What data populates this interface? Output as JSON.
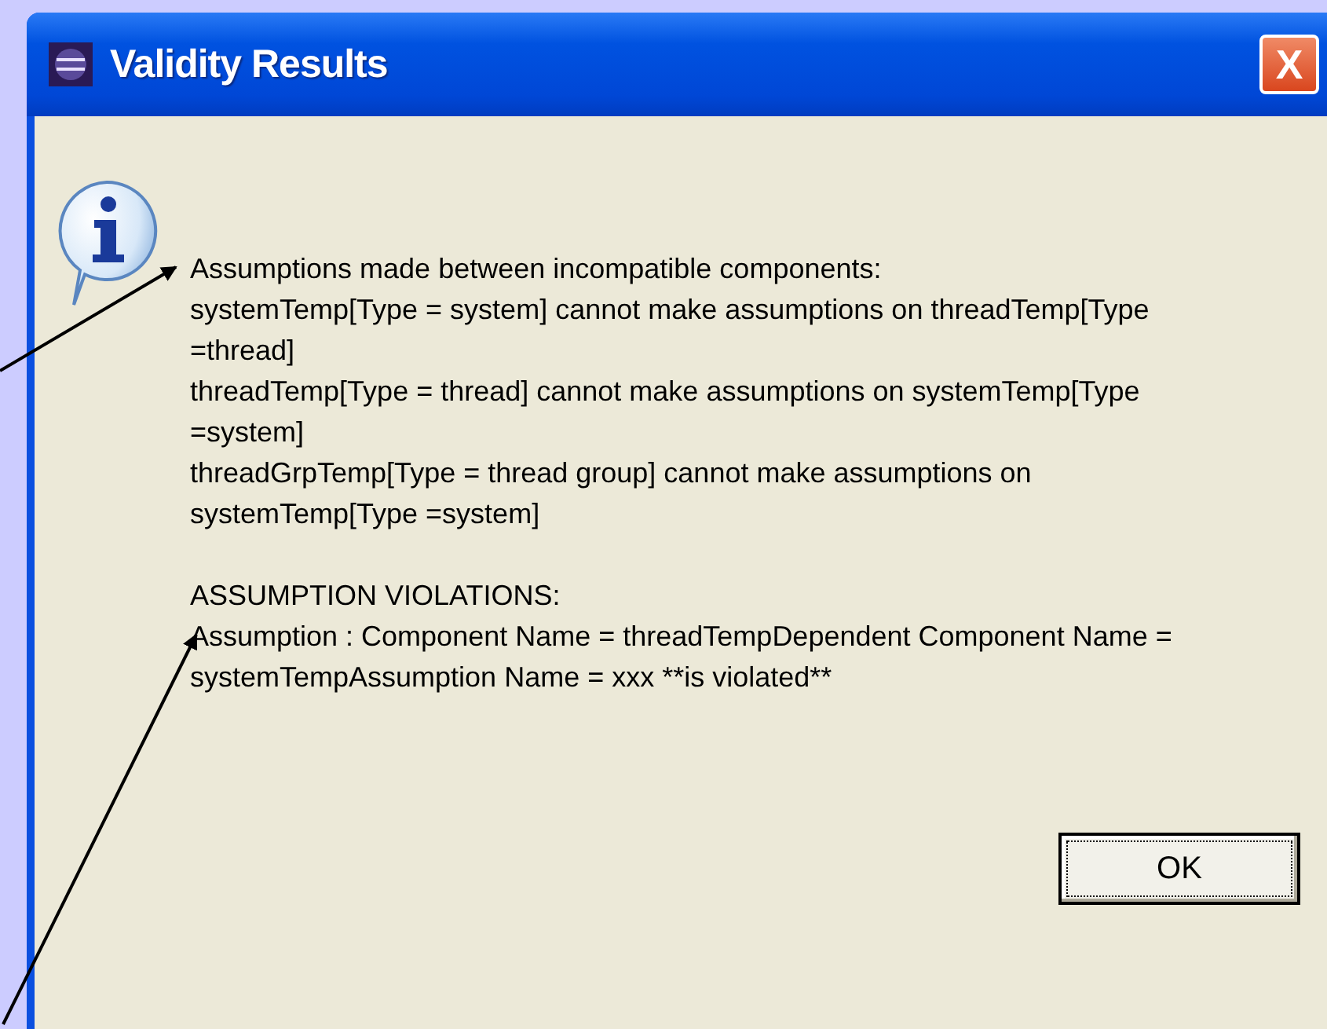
{
  "window": {
    "title": "Validity Results",
    "close_label": "X"
  },
  "message": {
    "sections": [
      {
        "lines": [
          "Assumptions made between incompatible components:",
          "systemTemp[Type = system] cannot make assumptions on threadTemp[Type",
          "=thread]",
          "threadTemp[Type = thread] cannot make assumptions on systemTemp[Type",
          "=system]",
          "threadGrpTemp[Type = thread group] cannot make assumptions on",
          "systemTemp[Type =system]"
        ]
      },
      {
        "lines": [
          "ASSUMPTION VIOLATIONS:",
          "Assumption : Component Name = threadTempDependent Component Name =",
          "systemTempAssumption Name = xxx **is violated**"
        ]
      }
    ]
  },
  "buttons": [
    {
      "label": "OK",
      "focused": true
    }
  ]
}
